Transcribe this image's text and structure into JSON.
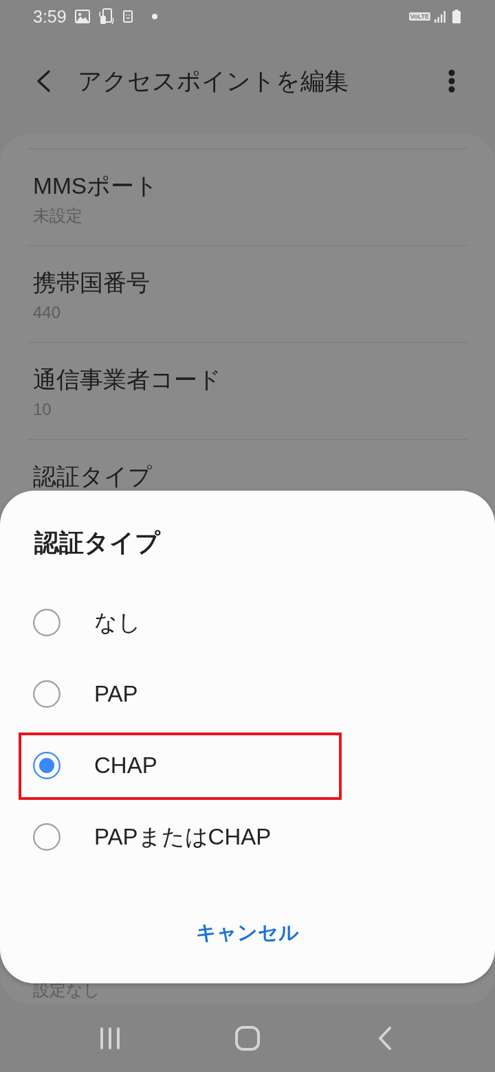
{
  "status_bar": {
    "time": "3:59",
    "network_badge": "VoLTE"
  },
  "header": {
    "title": "アクセスポイントを編集"
  },
  "settings": [
    {
      "title": "MMSポート",
      "summary": "未設定"
    },
    {
      "title": "携帯国番号",
      "summary": "440"
    },
    {
      "title": "通信事業者コード",
      "summary": "10"
    },
    {
      "title": "認証タイプ"
    },
    {
      "summary": "設定なし"
    }
  ],
  "dialog": {
    "title": "認証タイプ",
    "options": [
      {
        "label": "なし",
        "selected": false,
        "highlighted": false
      },
      {
        "label": "PAP",
        "selected": false,
        "highlighted": false
      },
      {
        "label": "CHAP",
        "selected": true,
        "highlighted": true
      },
      {
        "label": "PAPまたはCHAP",
        "selected": false,
        "highlighted": false
      }
    ],
    "cancel": "キャンセル"
  }
}
